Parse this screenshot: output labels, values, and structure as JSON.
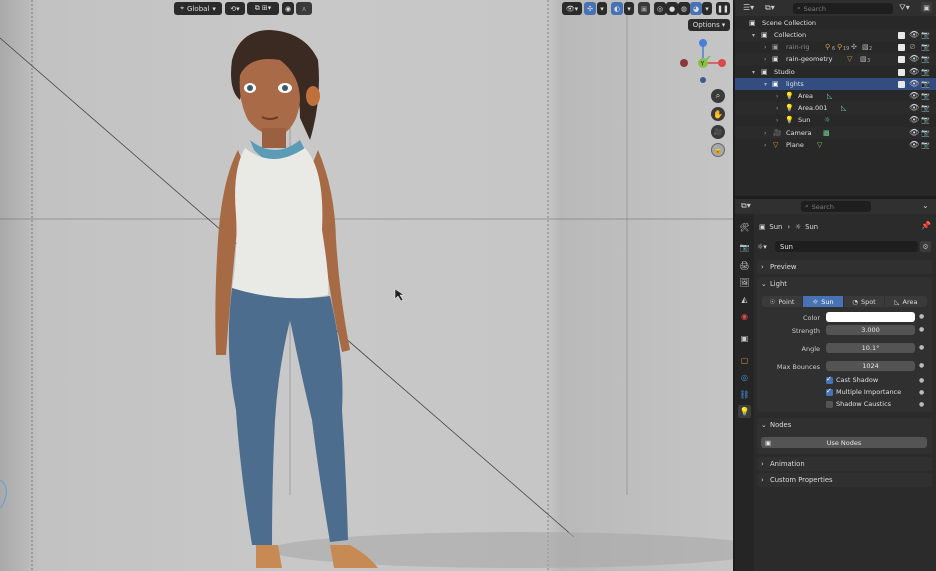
{
  "viewport": {
    "transform_orientation": "Global",
    "options_label": "Options",
    "gizmo": {
      "y_label": "Y"
    }
  },
  "outliner": {
    "search_placeholder": "Search",
    "root": "Scene Collection",
    "rows": [
      {
        "label": "Collection"
      },
      {
        "label": "rain-rig"
      },
      {
        "label": "rain-geometry"
      },
      {
        "label": "Studio"
      },
      {
        "label": "lights"
      },
      {
        "label": "Area"
      },
      {
        "label": "Area.001"
      },
      {
        "label": "Sun"
      },
      {
        "label": "Camera"
      },
      {
        "label": "Plane"
      }
    ],
    "rig_badges": [
      "6",
      "19",
      "2"
    ],
    "geometry_badges": [
      "",
      "3"
    ]
  },
  "properties": {
    "search_placeholder": "Search",
    "breadcrumb": {
      "object": "Sun",
      "data": "Sun"
    },
    "datablock_name": "Sun",
    "panels": {
      "preview": "Preview",
      "light": "Light",
      "nodes": "Nodes",
      "animation": "Animation",
      "custom_properties": "Custom Properties"
    },
    "light_types": [
      "Point",
      "Sun",
      "Spot",
      "Area"
    ],
    "active_light_type": "Sun",
    "fields": {
      "color_label": "Color",
      "color_value": "#ffffff",
      "strength_label": "Strength",
      "strength_value": "3.000",
      "angle_label": "Angle",
      "angle_value": "10.1°",
      "max_bounces_label": "Max Bounces",
      "max_bounces_value": "1024"
    },
    "checkboxes": [
      {
        "label": "Cast Shadow",
        "checked": true
      },
      {
        "label": "Multiple Importance",
        "checked": true
      },
      {
        "label": "Shadow Caustics",
        "checked": false
      }
    ],
    "use_nodes_label": "Use Nodes"
  },
  "colors": {
    "accent": "#4772b3",
    "selected_row": "#334d80"
  }
}
